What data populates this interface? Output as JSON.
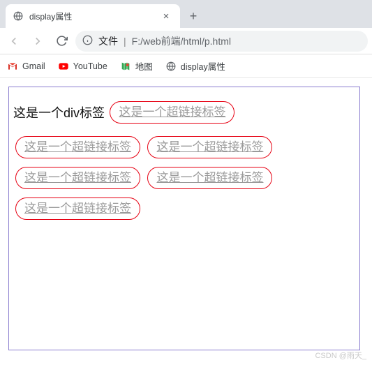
{
  "tab": {
    "title": "display属性"
  },
  "address": {
    "file_label": "文件",
    "path": "F:/web前端/html/p.html"
  },
  "bookmarks": [
    {
      "label": "Gmail"
    },
    {
      "label": "YouTube"
    },
    {
      "label": "地图"
    },
    {
      "label": "display属性"
    }
  ],
  "content": {
    "div_text": "这是一个div标签",
    "link_text": "这是一个超链接标签"
  },
  "watermark": "CSDN @雨天_"
}
